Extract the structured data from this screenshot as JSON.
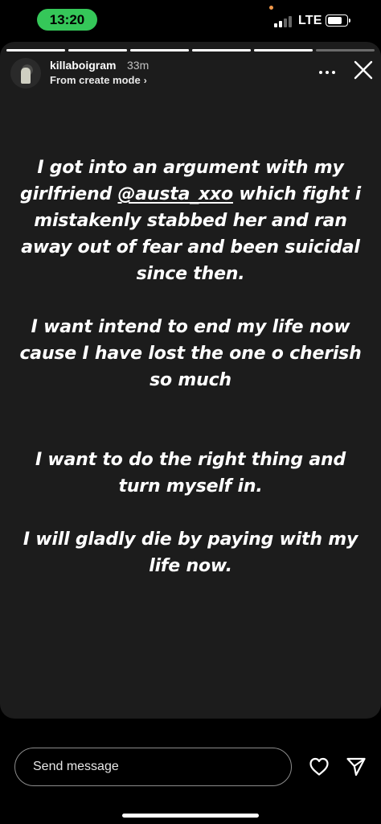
{
  "status_bar": {
    "time": "13:20",
    "network": "LTE",
    "battery_level": 0.8
  },
  "story": {
    "segments": [
      {
        "progress": 1.0
      },
      {
        "progress": 1.0
      },
      {
        "progress": 1.0
      },
      {
        "progress": 1.0
      },
      {
        "progress": 1.0
      },
      {
        "progress": 0.0
      }
    ],
    "header": {
      "username": "killaboigram",
      "timestamp": "33m",
      "mode_label": "From create mode",
      "mode_chevron": "›"
    },
    "text": {
      "p1_before": "I got into an argument with my girlfriend ",
      "p1_mention": "@austa_xxo",
      "p1_after": " which fight i mistakenly stabbed her and ran away out of fear and been suicidal since then.",
      "p2": "I want intend to end my life now cause I have lost the one o cherish so much",
      "p3": "I want to do the right thing and turn myself in.",
      "p4": "I will gladly die by paying with my life now."
    }
  },
  "bottom_bar": {
    "send_placeholder": "Send message"
  },
  "icons": {
    "more": "more-icon",
    "close": "close-icon",
    "heart": "heart-icon",
    "share": "paper-plane-icon"
  },
  "colors": {
    "time_pill": "#35c759",
    "story_background": "#1c1c1c"
  }
}
